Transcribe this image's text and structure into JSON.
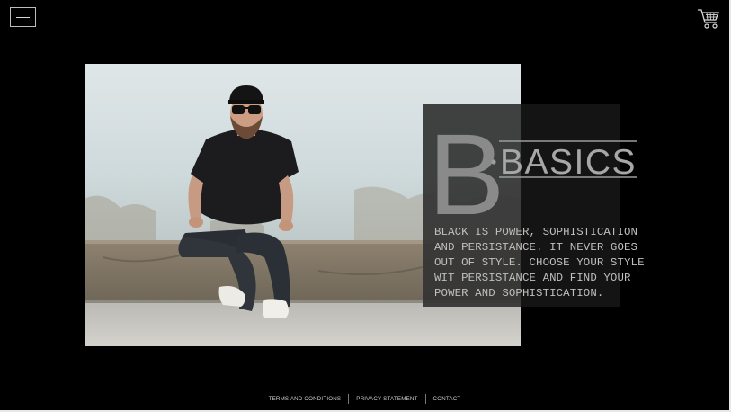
{
  "header": {
    "menu_icon": "hamburger-menu-icon",
    "cart_icon": "shopping-cart-icon"
  },
  "hero": {
    "image_alt": "Man in black t-shirt, cap and sunglasses sitting on a concrete ledge",
    "brand_letter": "B",
    "brand_name": "BASICS",
    "description": "BLACK IS POWER, SOPHISTICATION AND PERSISTANCE. IT NEVER GOES OUT OF STYLE. CHOOSE YOUR STYLE WIT PERSISTANCE AND FIND YOUR POWER AND SOPHISTICATION.",
    "description_lines": [
      "BLACK IS POWER, SOPHISTICATION",
      "AND PERSISTANCE. IT NEVER GOES",
      "OUT OF STYLE. CHOOSE YOUR STYLE",
      "WIT PERSISTANCE AND FIND YOUR",
      "POWER AND SOPHISTICATION."
    ]
  },
  "footer": {
    "links": [
      "TERMS AND CONDITIONS",
      "PRIVACY STATEMENT",
      "CONTACT"
    ]
  },
  "colors": {
    "background": "#000000",
    "panel": "#343434",
    "text_muted": "#bfbfbf",
    "logo_gray": "#8a8a8a"
  }
}
